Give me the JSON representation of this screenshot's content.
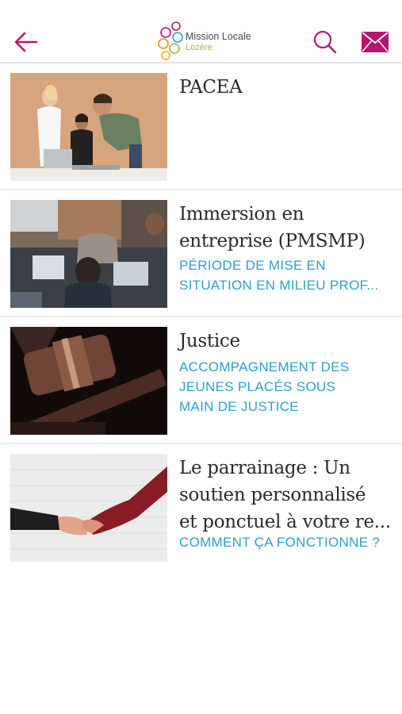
{
  "header": {
    "logo_line1": "Mission Locale",
    "logo_line2": "Lozère",
    "accent_color": "#b5176d",
    "back_icon": "arrow-left-icon",
    "search_icon": "search-icon",
    "mail_icon": "envelope-icon"
  },
  "items": [
    {
      "title": "PACEA",
      "subtitle": "",
      "image": "people-at-laptop-photo"
    },
    {
      "title_line1": "Immersion en",
      "title_line2": "entreprise (PMSMP)",
      "subtitle_line1": "PÉRIODE DE MISE EN",
      "subtitle_line2": "SITUATION EN MILIEU PROF...",
      "image": "team-working-laptops-photo"
    },
    {
      "title": "Justice",
      "subtitle_line1": "ACCOMPAGNEMENT DES",
      "subtitle_line2": "JEUNES PLACÉS SOUS",
      "subtitle_line3": "MAIN DE JUSTICE",
      "image": "judge-gavel-photo"
    },
    {
      "title_line1": "Le parrainage : Un",
      "title_line2": "soutien personnalisé",
      "title_line3": "et ponctuel à votre re...",
      "subtitle": "COMMENT ÇA FONCTIONNE ?",
      "image": "handshake-photo"
    }
  ]
}
